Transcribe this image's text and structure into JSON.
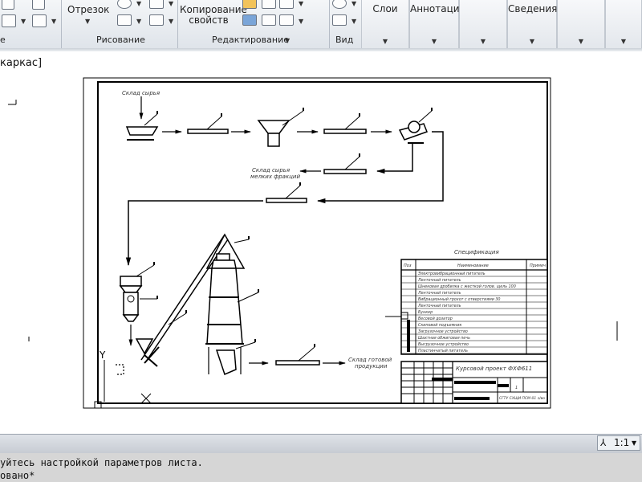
{
  "ribbon": {
    "buttons": {
      "segment": "Отрезок",
      "copy_properties_line1": "Копирование",
      "copy_properties_line2": "свойств"
    },
    "panels": {
      "left_partial": "е",
      "draw": "Рисование",
      "modify": "Редактирование",
      "view": "Вид"
    },
    "tabs": {
      "layers": "Слои",
      "annotations": "Аннотации",
      "info": "Сведения"
    }
  },
  "viewport": {
    "label": "каркас]"
  },
  "status": {
    "scale": "1:1"
  },
  "command_line": {
    "line1": "уйтесь настройкой параметров листа.",
    "line2": "овано*"
  },
  "drawing": {
    "label_raw_warehouse": "Склад сырья",
    "label_fine_fractions_1": "Склад сырья",
    "label_fine_fractions_2": "мелких фракций",
    "label_finished_1": "Склад готовой",
    "label_finished_2": "продукции",
    "spec_title": "Спецификация",
    "spec_header_pos": "Поз",
    "spec_header_name": "Наименование",
    "spec_header_note": "Примеч",
    "spec_rows": [
      "Электровибрационный питатель",
      "Ленточный питатель",
      "Шнековая дробилка с жесткой голов. щель 100",
      "Ленточный питатель",
      "Вибрационный грохот с отверстиями 30",
      "Ленточный питатель",
      "Бункер",
      "Весовой дозатор",
      "Скиповой подъемник",
      "Загрузочное устройство",
      "Шахтная обжиговая печь",
      "Выгрузочное устройство",
      "Пластинчатый питатель"
    ],
    "stamp_title": "Курсовой проект ФХФ611",
    "stamp_org": "СГТУ СХЩИ ПСМ-01 з/во",
    "stamp_sheet": "1",
    "axis_y": "Y"
  }
}
